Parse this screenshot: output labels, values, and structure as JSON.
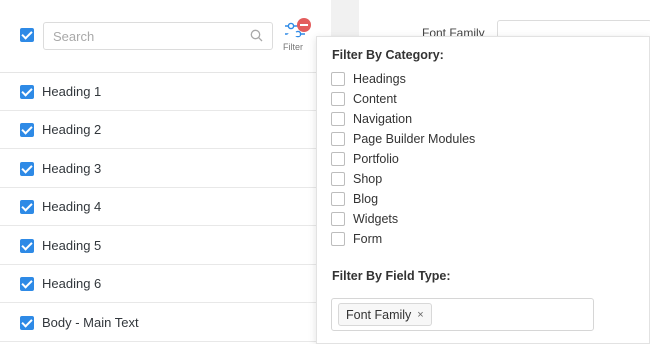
{
  "search": {
    "placeholder": "Search"
  },
  "filter": {
    "label": "Filter"
  },
  "list": {
    "items": [
      {
        "label": "Heading 1"
      },
      {
        "label": "Heading 2"
      },
      {
        "label": "Heading 3"
      },
      {
        "label": "Heading 4"
      },
      {
        "label": "Heading 5"
      },
      {
        "label": "Heading 6"
      },
      {
        "label": "Body - Main Text"
      }
    ]
  },
  "background": {
    "font_family_label": "Font Family"
  },
  "popover": {
    "category_title": "Filter By Category:",
    "categories": [
      {
        "label": "Headings"
      },
      {
        "label": "Content"
      },
      {
        "label": "Navigation"
      },
      {
        "label": "Page Builder Modules"
      },
      {
        "label": "Portfolio"
      },
      {
        "label": "Shop"
      },
      {
        "label": "Blog"
      },
      {
        "label": "Widgets"
      },
      {
        "label": "Form"
      }
    ],
    "field_type_title": "Filter By Field Type:",
    "field_type_tags": [
      {
        "label": "Font Family",
        "remove": "×"
      }
    ]
  },
  "colors": {
    "accent": "#2e8ae6",
    "badge": "#e35d5d"
  }
}
